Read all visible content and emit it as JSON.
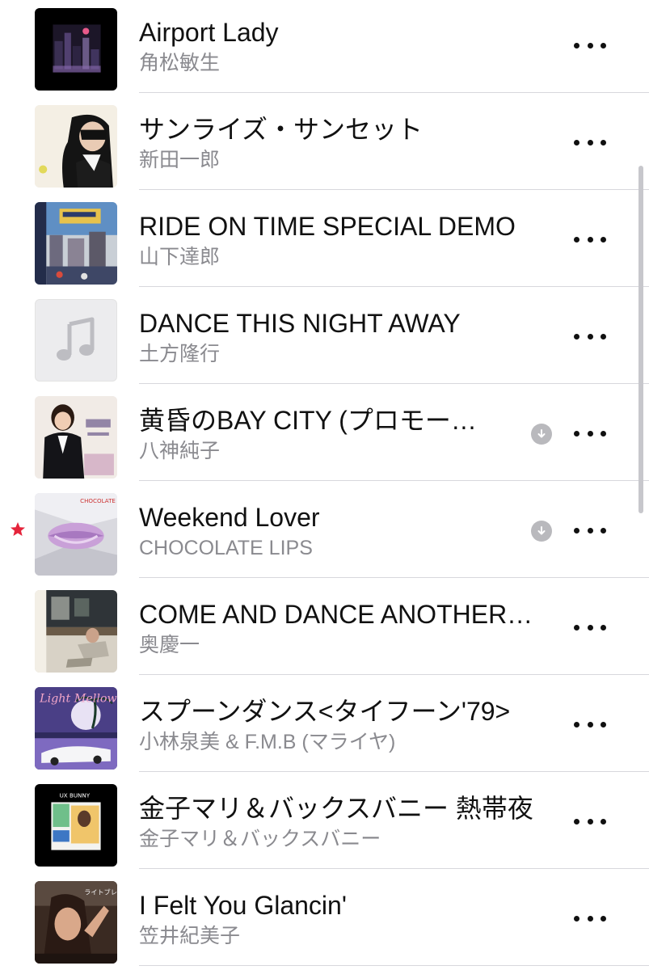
{
  "accent_colors": {
    "star": "#e5243b",
    "secondary_text": "#8a8a8f",
    "download_icon": "#b9b9bd"
  },
  "songs": [
    {
      "title": "Airport Lady",
      "artist": "角松敏生",
      "art_icon": "album-art"
    },
    {
      "title": "サンライズ・サンセット",
      "artist": "新田一郎",
      "art_icon": "album-art"
    },
    {
      "title": "RIDE ON TIME SPECIAL DEMO",
      "artist": "山下達郎",
      "art_icon": "album-art"
    },
    {
      "title": "DANCE THIS NIGHT AWAY",
      "artist": "土方隆行",
      "art_icon": "music-note-placeholder-icon"
    },
    {
      "title": "黄昏のBAY CITY (プロモー…",
      "artist": "八神純子",
      "art_icon": "album-art",
      "downloaded": true
    },
    {
      "title": "Weekend Lover",
      "artist": "CHOCOLATE LIPS",
      "art_icon": "album-art",
      "downloaded": true,
      "starred": true
    },
    {
      "title": "COME AND DANCE ANOTHER…",
      "artist": "奥慶一",
      "art_icon": "album-art"
    },
    {
      "title": "スプーンダンス<タイフーン'79>",
      "artist": "小林泉美 & F.M.B (マライヤ)",
      "art_icon": "album-art"
    },
    {
      "title": "金子マリ＆バックスバニー 熱帯夜",
      "artist": "金子マリ＆バックスバニー",
      "art_icon": "album-art"
    },
    {
      "title": " I Felt You Glancin'",
      "artist": "笠井紀美子",
      "art_icon": "album-art"
    }
  ]
}
